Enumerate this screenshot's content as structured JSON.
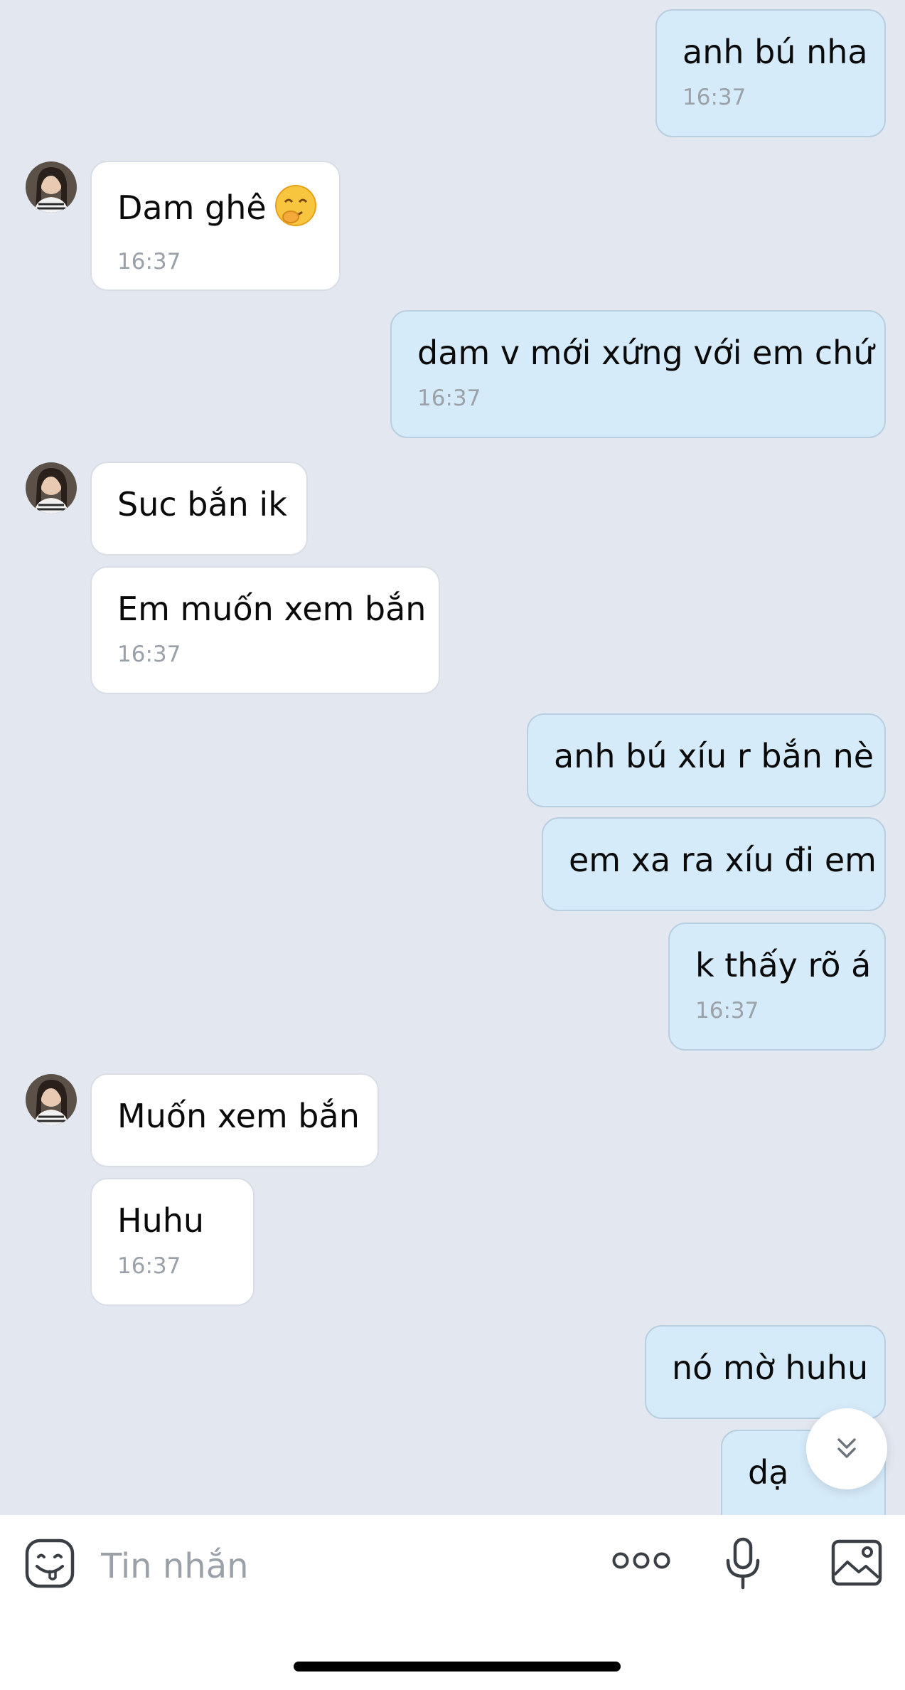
{
  "messages": [
    {
      "side": "out",
      "text": "anh bú nha",
      "time": "16:37"
    },
    {
      "side": "in",
      "text": "Dam ghê",
      "emoji": "thinking-laughing-emoji",
      "time": "16:37"
    },
    {
      "side": "out",
      "text": "dam v mới xứng với em chứ",
      "time": "16:37"
    },
    {
      "side": "in",
      "text": "Suc bắn ik"
    },
    {
      "side": "in",
      "text": "Em muốn xem bắn",
      "time": "16:37"
    },
    {
      "side": "out",
      "text": "anh bú xíu r bắn nè"
    },
    {
      "side": "out",
      "text": "em xa ra xíu đi em"
    },
    {
      "side": "out",
      "text": "k thấy rõ á",
      "time": "16:37"
    },
    {
      "side": "in",
      "text": "Muốn xem bắn"
    },
    {
      "side": "in",
      "text": "Huhu",
      "time": "16:37"
    },
    {
      "side": "out",
      "text": "nó mờ huhu"
    },
    {
      "side": "out",
      "text": "dạ"
    }
  ],
  "composer": {
    "placeholder": "Tin nhắn",
    "icons": [
      "sticker-icon",
      "more-icon",
      "microphone-icon",
      "image-icon"
    ]
  },
  "scroll_down_icon": "chevron-double-down-icon",
  "colors": {
    "background": "#e2e7f0",
    "incoming_bubble": "#ffffff",
    "outgoing_bubble": "#d6ebfa",
    "timestamp": "#9aa1a8",
    "icon": "#3a3f45"
  }
}
